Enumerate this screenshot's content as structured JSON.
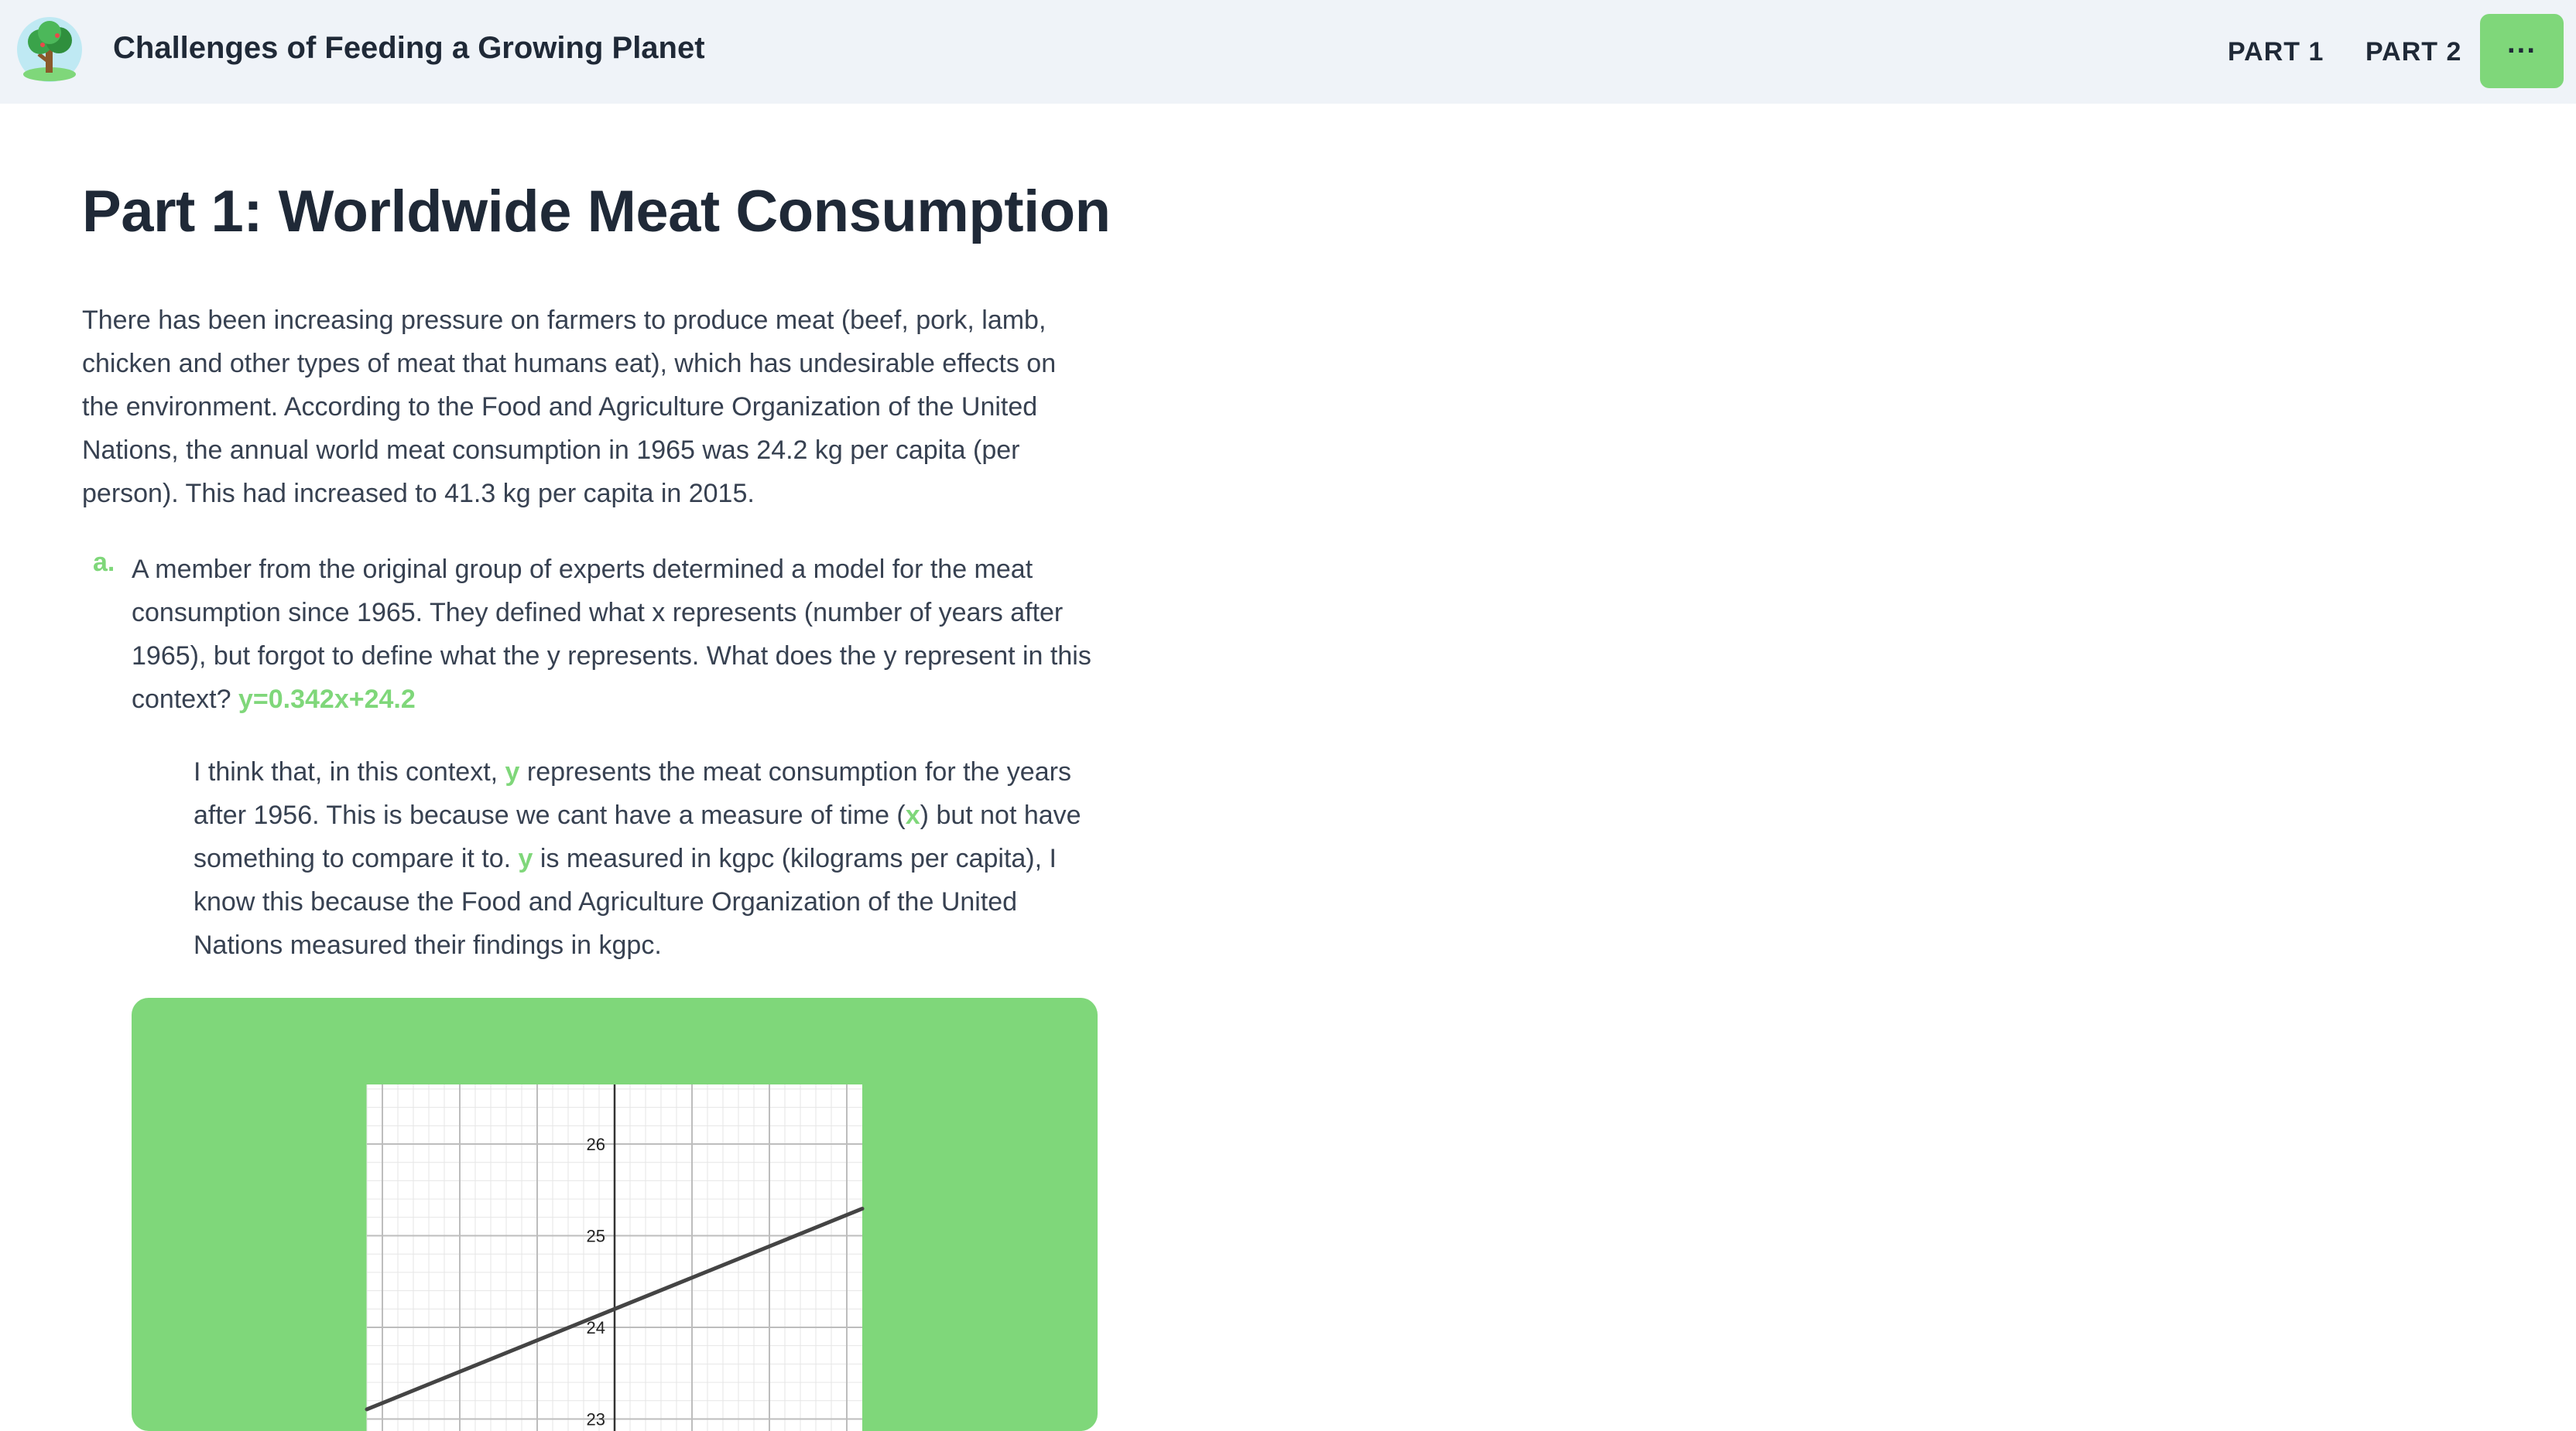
{
  "header": {
    "title": "Challenges of Feeding a Growing Planet",
    "nav": [
      "PART 1",
      "PART 2"
    ],
    "more_label": "···",
    "logo_icon": "tree-icon"
  },
  "main": {
    "title": "Part 1: Worldwide Meat Consumption",
    "intro": "There has been increasing pressure on farmers to produce meat (beef, pork, lamb, chicken and other types of meat that humans eat), which has undesirable effects on the environment. According to the Food and Agriculture Organization of the United Nations, the annual world meat consumption in 1965 was 24.2 kg per capita (per person). This had increased to 41.3 kg per capita in 2015.",
    "question": {
      "letter": "a.",
      "text": "A member from the original group of experts determined a model for the meat consumption since 1965. They defined what x represents (number of years after 1965), but forgot to define what the y represents. What does the y represent in this context?",
      "equation": "y=0.342x+24.2"
    },
    "answer": {
      "part1": "I think that, in this context,",
      "var_y": "y",
      "part2": "represents the meat consumption for the years after 1956. This is because we cant have a measure of time (",
      "var_x": "x",
      "part3": ") but not have something to compare it to.",
      "var_y2": "y",
      "part4": "is measured in kgpc (kilograms per capita), I know this because the Food and Agriculture Organization of the United Nations measured their findings in kgpc."
    }
  },
  "colors": {
    "accent": "#7fd77a",
    "header_bg": "#eff3f8",
    "text": "#1f2937"
  },
  "chart_data": {
    "type": "line",
    "title": "",
    "xlabel": "",
    "ylabel": "",
    "xlim": [
      -3.2,
      3.2
    ],
    "ylim": [
      22.7,
      26.65
    ],
    "yticks": [
      23,
      24,
      25,
      26
    ],
    "grid": true,
    "series": [
      {
        "slope": 0.342,
        "intercept": 24.2
      }
    ]
  }
}
